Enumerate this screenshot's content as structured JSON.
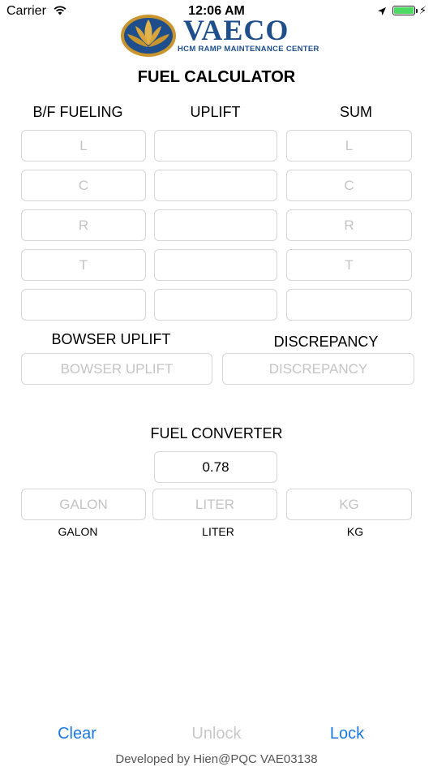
{
  "status_bar": {
    "carrier": "Carrier",
    "time": "12:06 AM"
  },
  "logo": {
    "name": "VAECO",
    "subtitle": "HCM RAMP MAINTENANCE CENTER",
    "brand_color": "#1e4f8c",
    "mark_color": "#c9952d"
  },
  "title": "FUEL CALCULATOR",
  "columns": {
    "bf_fueling": "B/F FUELING",
    "uplift": "UPLIFT",
    "sum": "SUM"
  },
  "bf_fueling": {
    "placeholders": [
      "L",
      "C",
      "R",
      "T",
      ""
    ]
  },
  "uplift": {
    "placeholders": [
      "",
      "",
      "",
      "",
      ""
    ]
  },
  "sum": {
    "placeholders": [
      "L",
      "C",
      "R",
      "T",
      ""
    ]
  },
  "bowser": {
    "label": "BOWSER UPLIFT",
    "placeholder": "BOWSER UPLIFT"
  },
  "discrepancy": {
    "label": "DISCREPANCY",
    "placeholder": "DISCREPANCY"
  },
  "converter": {
    "title": "FUEL CONVERTER",
    "density_value": "0.78",
    "galon": {
      "placeholder": "GALON",
      "label": "GALON"
    },
    "liter": {
      "placeholder": "LITER",
      "label": "LITER"
    },
    "kg": {
      "placeholder": "KG",
      "label": "KG"
    }
  },
  "buttons": {
    "clear": "Clear",
    "unlock": "Unlock",
    "lock": "Lock",
    "accent_color": "#1b78e3"
  },
  "footer": "Developed by Hien@PQC VAE03138"
}
